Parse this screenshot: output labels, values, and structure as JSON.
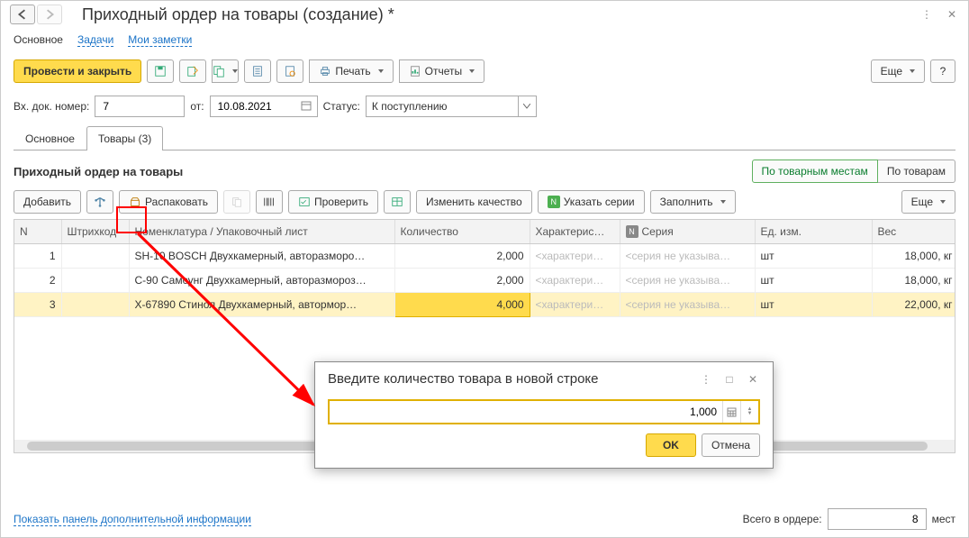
{
  "window": {
    "title": "Приходный ордер на товары (создание) *"
  },
  "section_tabs": {
    "main": "Основное",
    "tasks": "Задачи",
    "notes": "Мои заметки"
  },
  "main_toolbar": {
    "post_close": "Провести и закрыть",
    "print": "Печать",
    "reports": "Отчеты",
    "more": "Еще",
    "help": "?"
  },
  "form": {
    "doc_num_label": "Вх. док. номер:",
    "doc_num_value": "7",
    "date_label": "от:",
    "date_value": "10.08.2021",
    "status_label": "Статус:",
    "status_value": "К поступлению"
  },
  "content_tabs": {
    "main": "Основное",
    "goods": "Товары (3)"
  },
  "sub": {
    "title": "Приходный ордер на товары",
    "by_places": "По товарным местам",
    "by_goods": "По товарам"
  },
  "grid_toolbar": {
    "add": "Добавить",
    "unpack": "Распаковать",
    "check": "Проверить",
    "change_quality": "Изменить качество",
    "set_series": "Указать серии",
    "fill": "Заполнить",
    "more": "Еще"
  },
  "grid": {
    "headers": {
      "n": "N",
      "barcode": "Штрихкод",
      "nomenclature": "Номенклатура / Упаковочный лист",
      "qty": "Количество",
      "char": "Характерис…",
      "serial": "Серия",
      "unit": "Ед. изм.",
      "weight": "Вес"
    },
    "placeholders": {
      "char": "<характери…",
      "serial": "<серия не указыва…"
    },
    "rows": [
      {
        "n": "1",
        "nom": "SH-10 BOSCH Двухкамерный, авторазморо…",
        "qty": "2,000",
        "unit": "шт",
        "weight": "18,000, кг"
      },
      {
        "n": "2",
        "nom": "С-90 Самсунг Двухкамерный, авторазмороз…",
        "qty": "2,000",
        "unit": "шт",
        "weight": "18,000, кг"
      },
      {
        "n": "3",
        "nom": "Х-67890 Стинол Двухкамерный, автормор…",
        "qty": "4,000",
        "unit": "шт",
        "weight": "22,000, кг"
      }
    ]
  },
  "modal": {
    "title": "Введите количество товара в новой строке",
    "value": "1,000",
    "ok": "OK",
    "cancel": "Отмена"
  },
  "footer": {
    "link": "Показать панель дополнительной информации",
    "total_label": "Всего в ордере:",
    "total_value": "8",
    "unit": "мест"
  }
}
